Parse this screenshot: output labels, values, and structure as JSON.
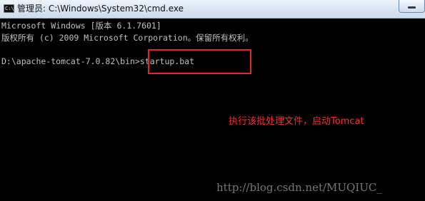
{
  "window": {
    "title": "管理员: C:\\Windows\\System32\\cmd.exe",
    "icon_name": "console-icon",
    "icon_glyph": "C:\\",
    "minimize_icon": "minimize-icon"
  },
  "console": {
    "lines": [
      "Microsoft Windows [版本 6.1.7601]",
      "版权所有 (c) 2009 Microsoft Corporation。保留所有权利。",
      "",
      "D:\\apache-tomcat-7.0.82\\bin>startup.bat"
    ]
  },
  "annotation": {
    "note": "执行该批处理文件，启动Tomcat",
    "color": "#e3262a"
  },
  "watermark": {
    "text": "http://blog.csdn.net/MUQIUC_"
  }
}
